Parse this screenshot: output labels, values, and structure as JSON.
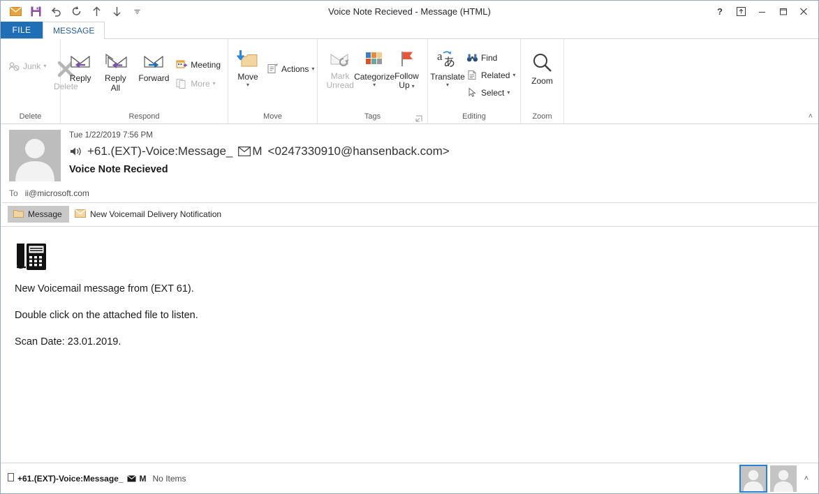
{
  "window": {
    "title": "Voice Note Recieved  - Message (HTML)",
    "help_label": "?",
    "restore_down_label": "❐",
    "minimize_label": "–",
    "maximize_label": "❐",
    "close_label": "✕"
  },
  "quick_access": {
    "items": [
      {
        "name": "mail-icon",
        "tooltip": "Mail"
      },
      {
        "name": "save-icon",
        "tooltip": "Save"
      },
      {
        "name": "undo-icon",
        "tooltip": "Undo"
      },
      {
        "name": "redo-icon",
        "tooltip": "Redo"
      },
      {
        "name": "previous-item-icon",
        "tooltip": "Previous Item"
      },
      {
        "name": "next-item-icon",
        "tooltip": "Next Item"
      },
      {
        "name": "customize-quick-access-toolbar-icon",
        "tooltip": "Customize Quick Access Toolbar"
      }
    ]
  },
  "ribbon": {
    "file_tab": "FILE",
    "tabs": [
      {
        "label": "MESSAGE",
        "active": true
      }
    ],
    "collapse_label": "˄",
    "groups": [
      {
        "label": "Delete",
        "buttons": [
          {
            "label": "Junk",
            "type": "small",
            "disabled": true,
            "caret": true
          },
          {
            "label": "Delete",
            "type": "big",
            "disabled": true
          }
        ]
      },
      {
        "label": "Respond",
        "buttons": [
          {
            "label": "Reply",
            "type": "big",
            "disabled": false
          },
          {
            "label": "Reply All",
            "type": "big",
            "disabled": false
          },
          {
            "label": "Forward",
            "type": "big",
            "disabled": false
          },
          {
            "label": "Meeting",
            "type": "small",
            "disabled": false
          },
          {
            "label": "More",
            "type": "small",
            "disabled": true,
            "caret": true
          }
        ]
      },
      {
        "label": "Move",
        "buttons": [
          {
            "label": "Move",
            "type": "big",
            "caret": true
          },
          {
            "label": "Actions",
            "type": "small",
            "caret": true
          }
        ]
      },
      {
        "label": "Tags",
        "has_dialog_launcher": true,
        "buttons": [
          {
            "label": "Mark Unread",
            "type": "big",
            "disabled": true
          },
          {
            "label": "Categorize",
            "type": "big",
            "caret": true
          },
          {
            "label": "Follow Up",
            "type": "big",
            "caret": true
          }
        ]
      },
      {
        "label": "Editing",
        "buttons": [
          {
            "label": "Translate",
            "type": "big",
            "caret": true
          },
          {
            "label": "Find",
            "type": "small"
          },
          {
            "label": "Related",
            "type": "small",
            "caret": true
          },
          {
            "label": "Select",
            "type": "small",
            "caret": true
          }
        ]
      },
      {
        "label": "Zoom",
        "buttons": [
          {
            "label": "Zoom",
            "type": "big"
          }
        ]
      }
    ]
  },
  "message": {
    "date": "Tue 1/22/2019 7:56 PM",
    "from_prefix_icon": "speaker-icon",
    "from_name": "+61.(EXT)-Voice:Message_",
    "from_name_icon": "envelope-glyph",
    "from_name_suffix": "M",
    "from_address": "<0247330910@hansenback.com>",
    "subject": "Voice Note Recieved",
    "to_label": "To",
    "to_value": "ii@microsoft.com",
    "item_tabs": [
      {
        "label": "Message",
        "icon": "message-page-icon",
        "selected": true
      },
      {
        "label": "New Voicemail Delivery Notification",
        "icon": "envelope-attachment-icon",
        "selected": false
      }
    ],
    "body": {
      "icon": "desk-phone-icon",
      "paragraphs": [
        "New Voicemail message  from (EXT 61).",
        "Double click on the attached file to listen.",
        "Scan Date: 23.01.2019."
      ]
    }
  },
  "status_bar": {
    "item_icon": "small-square-icon",
    "sender": "+61.(EXT)-Voice:Message_",
    "sender_icon": "envelope-glyph",
    "sender_suffix": "M",
    "count_label": "No Items",
    "views": [
      {
        "name": "people-pane-thumb-1",
        "selected": true
      },
      {
        "name": "people-pane-thumb-2",
        "selected": false
      }
    ],
    "expand_label": "˄"
  },
  "colors": {
    "file_tab_blue": "#1f6fb6",
    "tab_text_blue": "#2a6099",
    "accent_orange": "#e8a33d",
    "flag_red": "#e8563a",
    "save_purple": "#8a4e9e",
    "selection_blue": "#2b7cd3"
  }
}
